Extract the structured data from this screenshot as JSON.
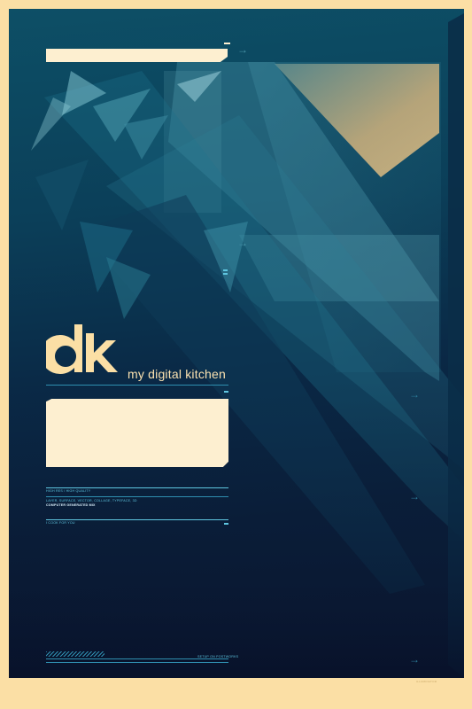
{
  "brand": {
    "logo_text": "dk",
    "tagline": "my digital kitchen"
  },
  "info": {
    "quality": "HIGH RES / HIGH QUALITY",
    "techniques": "LAYER, SURFACE, VECTOR, COLLAGE, TYPEFACE, 3D",
    "mix": "COMPUTER GENERATED MIX",
    "slogan": "I COOK FOR YOU",
    "bottom_right": "SETUP ON POSTWORKS",
    "footer": "ILLUMINATOR"
  },
  "icons": [
    "arrow-right-icon",
    "double-dash-icon"
  ],
  "colors": {
    "border": "#fbdfa5",
    "cream": "#fdefd0",
    "deep_navy": "#0b1631",
    "teal": "#0d4f66",
    "accent_cyan": "#5fc6e0"
  }
}
